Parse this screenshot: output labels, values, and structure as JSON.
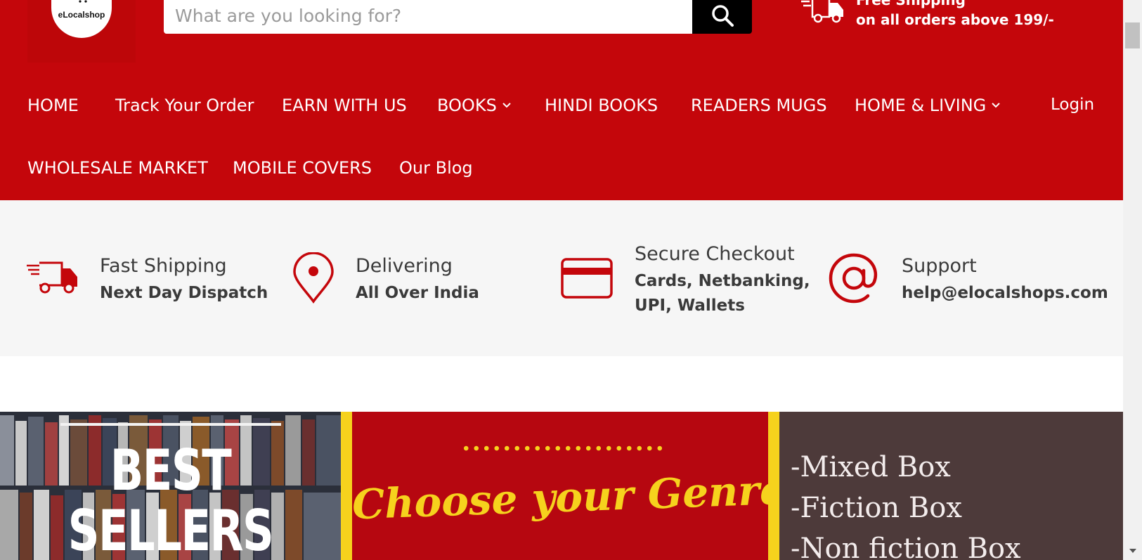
{
  "header": {
    "logo_text": "eLocalshop",
    "search": {
      "placeholder": "What are you looking for?"
    },
    "shipping": {
      "line1": "Free Shipping",
      "line2": "on all orders above 199/-"
    }
  },
  "nav": {
    "home": "HOME",
    "track": "Track Your Order",
    "earn": "EARN WITH US",
    "books": "BOOKS",
    "hindi": "HINDI BOOKS",
    "mugs": "READERS MUGS",
    "living": "HOME & LIVING",
    "login": "Login",
    "wholesale": "WHOLESALE MARKET",
    "mobile": "MOBILE COVERS",
    "blog": "Our Blog"
  },
  "features": [
    {
      "icon": "delivery-truck-icon",
      "title": "Fast Shipping",
      "sub": "Next Day Dispatch"
    },
    {
      "icon": "location-pin-icon",
      "title": "Delivering",
      "sub": "All Over India"
    },
    {
      "icon": "credit-card-icon",
      "title": "Secure Checkout",
      "sub1": "Cards, Netbanking,",
      "sub2": "UPI, Wallets"
    },
    {
      "icon": "at-sign-icon",
      "title": "Support",
      "sub": "help@elocalshops.com"
    }
  ],
  "banner": {
    "best_line1": "BEST",
    "best_line2": "SELLERS",
    "genre": "Choose your Genre",
    "boxes": [
      "-Mixed Box",
      "-Fiction Box",
      "-Non fiction Box"
    ]
  },
  "colors": {
    "brand_red": "#c4060b",
    "accent_yellow": "#f6d21d",
    "banner_brown": "#4d3a3a",
    "feature_bg": "#f6f6f6"
  }
}
